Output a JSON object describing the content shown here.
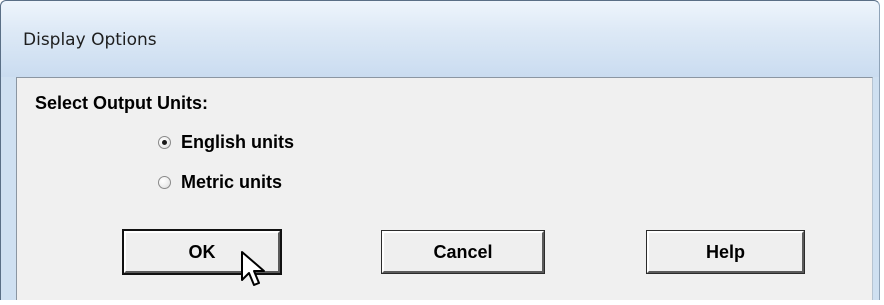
{
  "window": {
    "title": "Display Options"
  },
  "units": {
    "group_label": "Select Output Units:",
    "options": [
      {
        "label": "English units",
        "selected": true
      },
      {
        "label": "Metric units",
        "selected": false
      }
    ]
  },
  "buttons": {
    "ok_label": "OK",
    "cancel_label": "Cancel",
    "help_label": "Help"
  },
  "icons": {
    "cursor": "arrow-pointer-icon"
  }
}
